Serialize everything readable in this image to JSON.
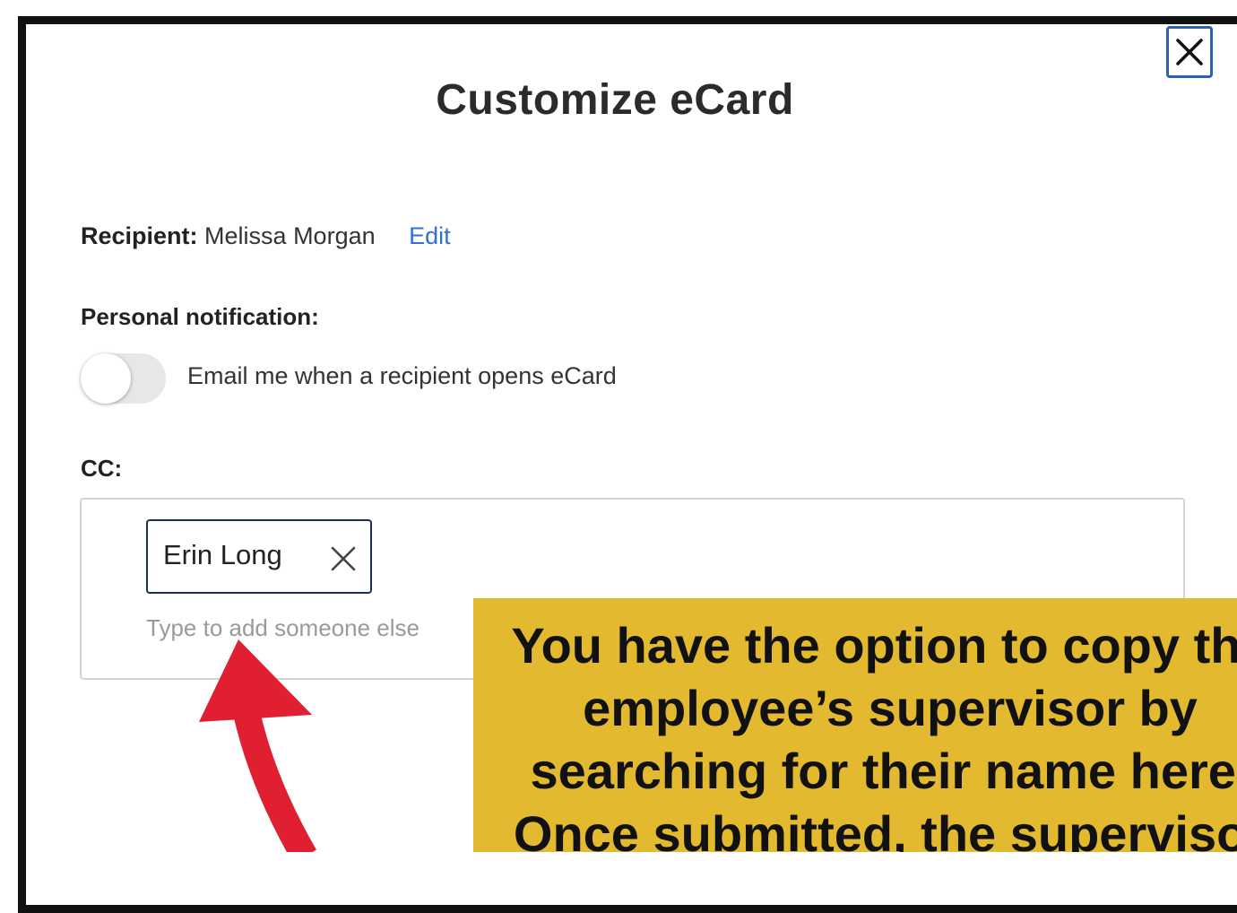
{
  "dialog": {
    "title": "Customize eCard",
    "close_icon": "close-icon"
  },
  "recipient": {
    "label": "Recipient:",
    "name": "Melissa Morgan",
    "edit_label": "Edit"
  },
  "notification": {
    "label": "Personal notification:",
    "toggle_on": false,
    "toggle_text": "Email me when a recipient opens eCard"
  },
  "cc": {
    "label": "CC:",
    "chips": [
      {
        "name": "Erin Long",
        "remove_icon": "close-icon"
      }
    ],
    "placeholder": "Type to add someone else"
  },
  "callout": {
    "text": "You have the option to copy the\nemployee’s supervisor by\nsearching for their name here.\nOnce submitted, the supervisor"
  },
  "annotation": {
    "arrow_icon": "curved-arrow-icon",
    "arrow_color": "#e02030",
    "callout_color": "#e3b930"
  },
  "colors": {
    "link": "#2f6fd6",
    "focus_border": "#2f5fb3",
    "chip_border": "#1f2d5c"
  }
}
